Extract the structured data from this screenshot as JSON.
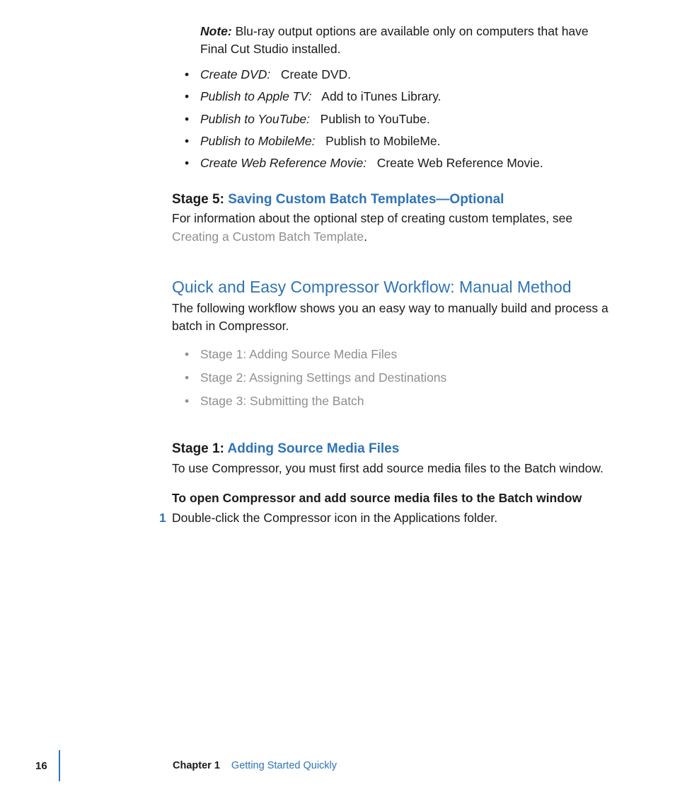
{
  "note": {
    "label": "Note:",
    "text": "Blu-ray output options are available only on computers that have Final Cut Studio installed."
  },
  "bullets": [
    {
      "label": "Create DVD:",
      "desc": "Create DVD."
    },
    {
      "label": "Publish to Apple TV:",
      "desc": "Add to iTunes Library."
    },
    {
      "label": "Publish to YouTube:",
      "desc": "Publish to YouTube."
    },
    {
      "label": "Publish to MobileMe:",
      "desc": "Publish to MobileMe."
    },
    {
      "label": "Create Web Reference Movie:",
      "desc": "Create Web Reference Movie."
    }
  ],
  "stage5": {
    "prefix": "Stage 5: ",
    "title": "Saving Custom Batch Templates—Optional",
    "para_before_link": "For information about the optional step of creating custom templates, see ",
    "link": "Creating a Custom Batch Template",
    "para_after_link": "."
  },
  "h2": "Quick and Easy Compressor Workflow: Manual Method",
  "h2_para": "The following workflow shows you an easy way to manually build and process a batch in Compressor.",
  "link_list": [
    "Stage 1: Adding Source Media Files",
    "Stage 2: Assigning Settings and Destinations",
    "Stage 3: Submitting the Batch"
  ],
  "stage1": {
    "prefix": "Stage 1: ",
    "title": "Adding Source Media Files",
    "para": "To use Compressor, you must first add source media files to the Batch window.",
    "task_heading": "To open Compressor and add source media files to the Batch window",
    "step_num": "1",
    "step_text": "Double-click the Compressor icon in the Applications folder."
  },
  "footer": {
    "page": "16",
    "chapter_label": "Chapter 1",
    "chapter_title": "Getting Started Quickly"
  }
}
